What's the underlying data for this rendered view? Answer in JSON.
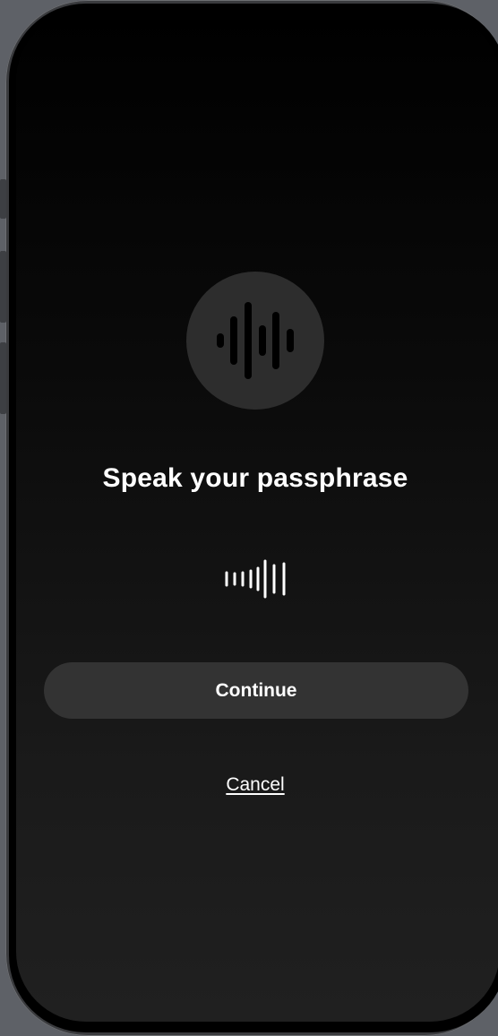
{
  "colors": {
    "background_top": "#000000",
    "background_bottom": "#202020",
    "icon_circle": "#2d2d2d",
    "button_bg": "#333333",
    "text": "#ffffff"
  },
  "icon": {
    "name": "waveform-icon"
  },
  "prompt": {
    "title": "Speak your passphrase"
  },
  "level_meter": {
    "name": "audio-level-meter"
  },
  "actions": {
    "continue_label": "Continue",
    "cancel_label": "Cancel"
  }
}
